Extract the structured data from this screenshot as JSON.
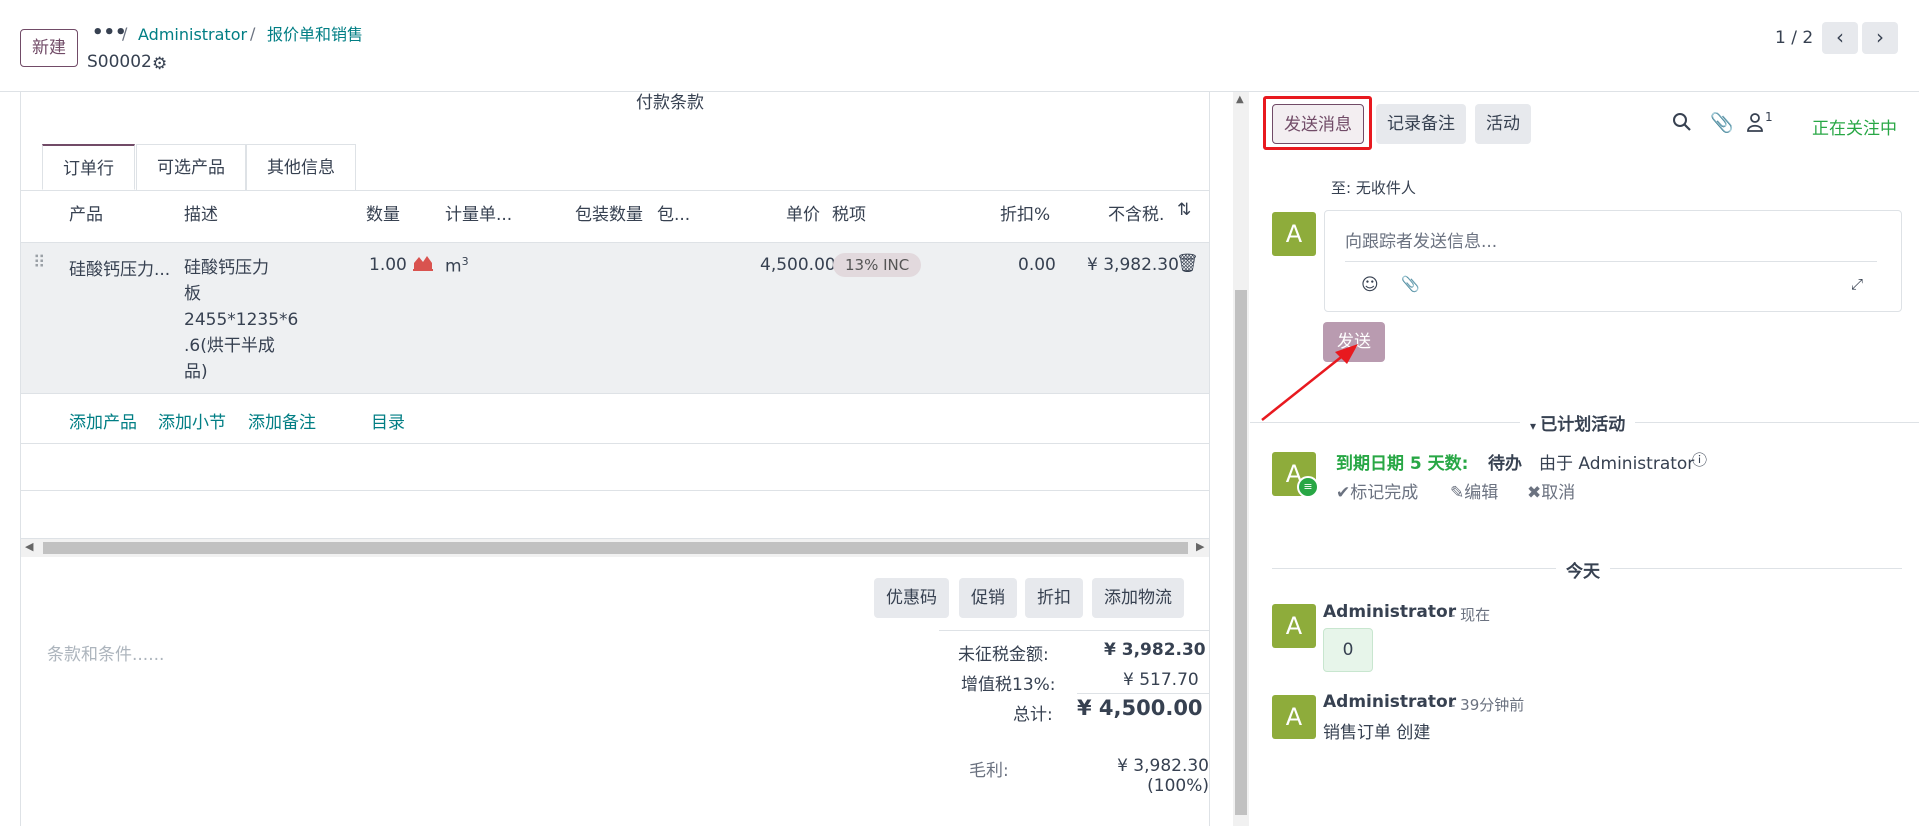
{
  "topbar": {
    "new_button": "新建",
    "breadcrumb_dots": "•••",
    "breadcrumb_sep": "/",
    "breadcrumb_1": "Administrator",
    "breadcrumb_2": "报价单和销售",
    "record_name": "S00002",
    "pager": "1 / 2"
  },
  "form": {
    "section_title": "付款条款",
    "tabs": [
      "订单行",
      "可选产品",
      "其他信息"
    ],
    "columns": [
      "产品",
      "描述",
      "数量",
      "计量单...",
      "包装数量",
      "包...",
      "单价",
      "税项",
      "折扣%",
      "不含税."
    ],
    "line": {
      "product": "硅酸钙压力...",
      "description_lines": [
        "硅酸钙压力",
        "板",
        "2455*1235*6",
        ".6(烘干半成",
        "品)"
      ],
      "quantity": "1.00",
      "uom": "m",
      "uom_sup": "3",
      "unit_price": "4,500.00",
      "tax": "13% INC",
      "discount": "0.00",
      "subtotal": "¥ 3,982.30"
    },
    "add_links": [
      "添加产品",
      "添加小节",
      "添加备注",
      "目录"
    ],
    "action_buttons": [
      "优惠码",
      "促销",
      "折扣",
      "添加物流"
    ],
    "terms_placeholder": "条款和条件......",
    "totals": {
      "untaxed_label": "未征税金额:",
      "untaxed_value": "¥ 3,982.30",
      "tax_label": "增值税13%:",
      "tax_value": "¥ 517.70",
      "total_label": "总计:",
      "total_value": "¥ 4,500.00",
      "margin_label": "毛利:",
      "margin_value": "¥ 3,982.30 (100%)"
    }
  },
  "chatter": {
    "send_message": "发送消息",
    "log_note": "记录备注",
    "activity": "活动",
    "follower_count": "1",
    "following": "正在关注中",
    "to_label": "至: 无收件人",
    "avatar_letter": "A",
    "composer_placeholder": "向跟踪者发送信息...",
    "send": "发送",
    "planned_activities": "已计划活动",
    "activity_due": "到期日期 5 天数:",
    "activity_type": "待办",
    "activity_by": "由于 Administrator",
    "mark_done": "标记完成",
    "edit": "编辑",
    "cancel": "取消",
    "today": "今天",
    "msg1_author": "Administrator",
    "msg1_time": "- 现在",
    "msg1_body": "0",
    "msg2_author": "Administrator",
    "msg2_time": "- 39分钟前",
    "msg2_body": "销售订单 创建"
  }
}
